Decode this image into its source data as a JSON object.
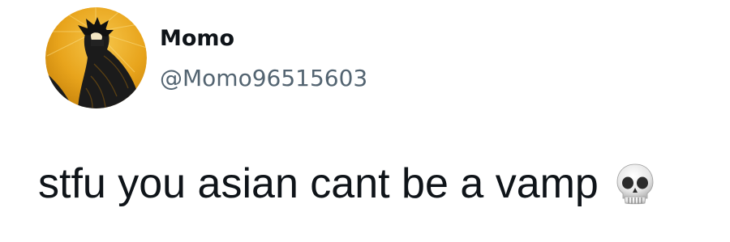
{
  "tweet": {
    "author": {
      "display_name": "Momo",
      "handle": "@Momo96515603",
      "avatar_icon": "profile-avatar"
    },
    "text": "stfu you asian cant be a vamp",
    "emoji": "skull-emoji"
  },
  "colors": {
    "text_primary": "#0f1419",
    "text_secondary": "#536471",
    "avatar_gold": "#e8a41c",
    "avatar_dark": "#1b1b1b"
  }
}
